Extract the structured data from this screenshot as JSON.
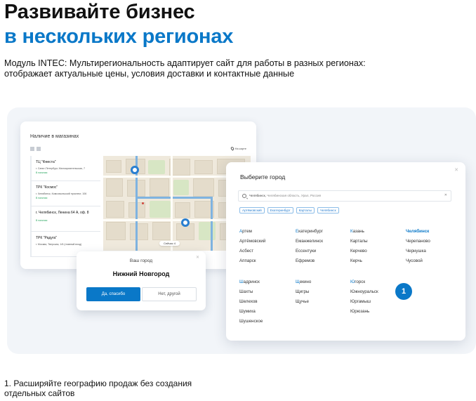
{
  "hero": {
    "title_line1": "Развивайте бизнес",
    "title_line2": "в нескольких регионах",
    "description": "Модуль INTEC: Мультирегиональность адаптирует сайт для работы в разных регионах: отображает актуальные цены, условия доставки и контактные данные"
  },
  "availability": {
    "title": "Наличие в магазинах",
    "map_toggle": "На карте",
    "map_control": "Сейчас 4",
    "stores": [
      {
        "name": "ТЦ \"Фиеста\"",
        "address": "г. Санкт-Петербург, Малоарханге­льская, 7",
        "stock": "В наличии"
      },
      {
        "name": "ТРК \"Космос\"",
        "address": "г. Челябинск, Комсомольский проспект, 106",
        "stock": "В наличии"
      },
      {
        "name": "г. Челябинск, Ленина 64 А, оф. 8",
        "address": "",
        "stock": "В наличии"
      },
      {
        "name": "ТРК \"Радуга\"",
        "address": "г. Москва, Тверская, 1/6 (главный вход)",
        "stock": ""
      }
    ]
  },
  "your_city": {
    "label": "Ваш город",
    "city": "Нижний Новгород",
    "yes": "Да, спасибо",
    "no": "Нет, другой"
  },
  "select_city": {
    "title": "Выберите город",
    "search_value": "Челябинск,",
    "search_hint": "Челябинская область, Урал, Россия",
    "chips": [
      "Артёмовский",
      "Екатеринбург",
      "Карталы",
      "Челябинск"
    ],
    "columns": [
      [
        "Артем",
        "Артёмовский",
        "Асбест",
        "Аппарск"
      ],
      [
        "Екатеринбург",
        "Еманжелинск",
        "Ессентуки",
        "Ефремов"
      ],
      [
        "Казань",
        "Карталы",
        "Керчево",
        "Керчь"
      ],
      [
        "Челябинск",
        "Черепаново",
        "Чернушка",
        "Чусовой"
      ],
      [
        "Шадринск",
        "Шахты",
        "Шелехов",
        "Шумиха",
        "Шушенское"
      ],
      [
        "Щекино",
        "Щигры",
        "Щучье"
      ],
      [
        "Югорск",
        "Южноуральск",
        "Юргамыш",
        "Юрюзань"
      ]
    ]
  },
  "badge": "1",
  "feature": "1. Расширяйте географию продаж без создания отдельных сайтов"
}
